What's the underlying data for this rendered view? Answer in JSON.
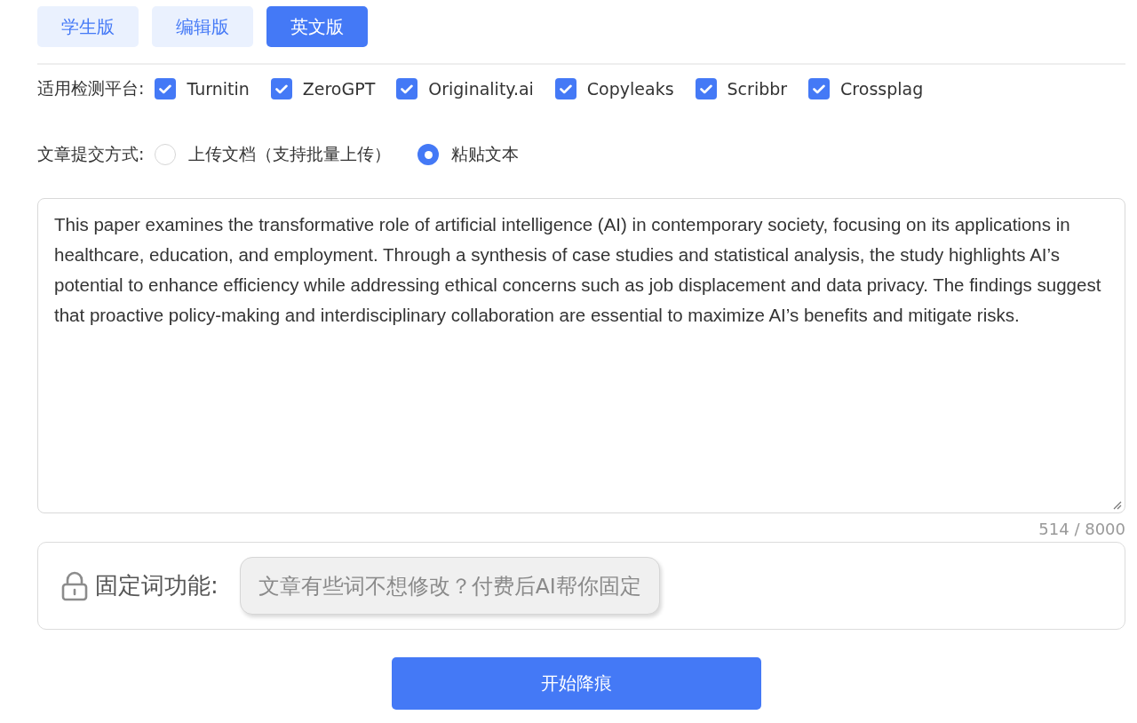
{
  "tabs": [
    {
      "label": "学生版",
      "selected": false
    },
    {
      "label": "编辑版",
      "selected": false
    },
    {
      "label": "英文版",
      "selected": true
    }
  ],
  "platforms": {
    "label": "适用检测平台:",
    "items": [
      {
        "label": "Turnitin",
        "checked": true
      },
      {
        "label": "ZeroGPT",
        "checked": true
      },
      {
        "label": "Originality.ai",
        "checked": true
      },
      {
        "label": "Copyleaks",
        "checked": true
      },
      {
        "label": "Scribbr",
        "checked": true
      },
      {
        "label": "Crossplag",
        "checked": true
      }
    ]
  },
  "submit_mode": {
    "label": "文章提交方式:",
    "options": [
      {
        "label": "上传文档（支持批量上传）",
        "selected": false
      },
      {
        "label": "粘贴文本",
        "selected": true
      }
    ]
  },
  "text_input": {
    "value": "This paper examines the transformative role of artificial intelligence (AI) in contemporary society, focusing on its applications in healthcare, education, and employment. Through a synthesis of case studies and statistical analysis, the study highlights AI’s potential to enhance efficiency while addressing ethical concerns such as job displacement and data privacy. The findings suggest that proactive policy-making and interdisciplinary collaboration are essential to maximize AI’s benefits and mitigate risks.",
    "counter": "514 / 8000"
  },
  "fixed_words": {
    "label": "固定词功能:",
    "prompt": "文章有些词不想修改？付费后AI帮你固定"
  },
  "start_button": {
    "label": "开始降痕"
  }
}
